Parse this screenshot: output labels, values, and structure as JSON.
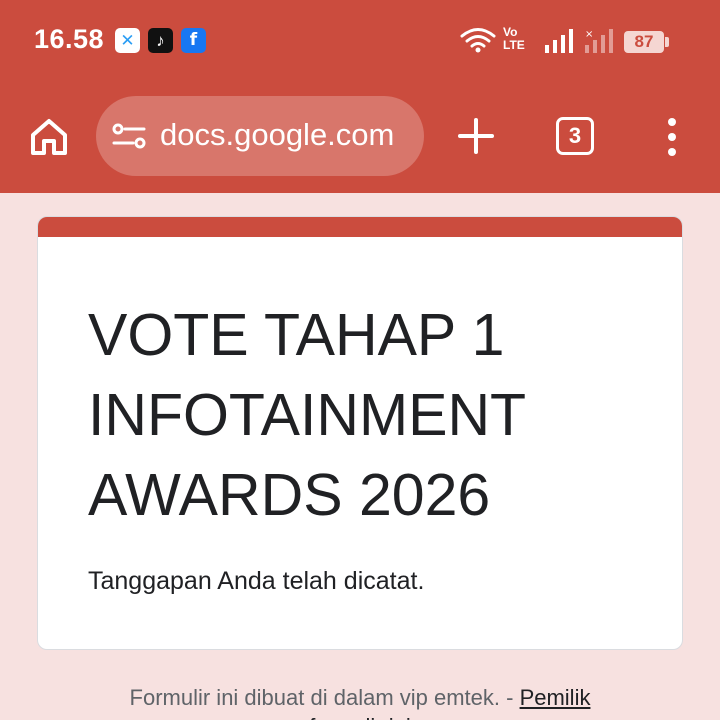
{
  "status_bar": {
    "time": "16.58",
    "notif_icons": [
      "xl-app-icon",
      "tiktok-icon",
      "facebook-icon"
    ],
    "volte_top": "Vo",
    "volte_bottom": "LTE",
    "battery": "87"
  },
  "browser": {
    "url": "docs.google.com",
    "tab_count": "3"
  },
  "form": {
    "title_lines": [
      "VOTE TAHAP 1",
      "INFOTAINMENT",
      "AWARDS 2026"
    ],
    "response_message": "Tanggapan Anda telah dicatat."
  },
  "footer": {
    "text": "Formulir ini dibuat di dalam vip emtek. - ",
    "link": "Pemilik",
    "link_continued": "formulir ini"
  },
  "colors": {
    "accent": "#cb4c3e",
    "background": "#f7e1e0",
    "url_pill": "#d8766b"
  }
}
